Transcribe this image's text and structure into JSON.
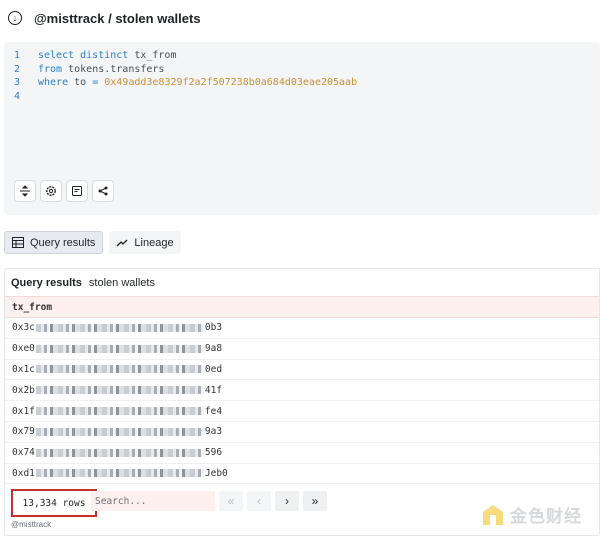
{
  "header": {
    "title": "@misttrack / stolen wallets",
    "back_icon": "arrow-circle-icon"
  },
  "editor": {
    "lines": [
      {
        "num": "1",
        "parts": [
          {
            "t": "kw",
            "v": "select distinct "
          },
          {
            "t": "plain",
            "v": "tx_from"
          }
        ]
      },
      {
        "num": "2",
        "parts": [
          {
            "t": "kw",
            "v": "from "
          },
          {
            "t": "plain",
            "v": "tokens.transfers"
          }
        ]
      },
      {
        "num": "3",
        "parts": [
          {
            "t": "kw",
            "v": "where "
          },
          {
            "t": "plain",
            "v": "to "
          },
          {
            "t": "kw",
            "v": "= "
          },
          {
            "t": "hex",
            "v": "0x49add3e8329f2a2f507238b0a684d03eae205aab"
          }
        ]
      },
      {
        "num": "4",
        "parts": []
      }
    ],
    "toolbar_icons": [
      "collapse-icon",
      "settings-icon",
      "notes-icon",
      "share-icon"
    ]
  },
  "tabs": [
    {
      "label": "Query results",
      "icon": "table-icon",
      "active": true
    },
    {
      "label": "Lineage",
      "icon": "lineage-icon",
      "active": false
    }
  ],
  "results": {
    "title": "Query results",
    "subtitle": "stolen wallets",
    "column": "tx_from",
    "rows": [
      {
        "prefix": "0x3c",
        "suffix": "0b3"
      },
      {
        "prefix": "0xe0",
        "suffix": "9a8"
      },
      {
        "prefix": "0x1c",
        "suffix": "0ed"
      },
      {
        "prefix": "0x2b",
        "suffix": "41f"
      },
      {
        "prefix": "0x1f",
        "suffix": "fe4"
      },
      {
        "prefix": "0x79",
        "suffix": "9a3"
      },
      {
        "prefix": "0x74",
        "suffix": "596"
      },
      {
        "prefix": "0xd1",
        "suffix": "Jeb0"
      }
    ],
    "row_count": "13,334 rows",
    "search_placeholder": "Search...",
    "pager": [
      "«",
      "‹",
      "›",
      "»"
    ]
  },
  "credit": "@misttrack",
  "watermark": "金色财经",
  "colors": {
    "highlight": "#c0312f",
    "keyword": "#2d7fc4",
    "hex_literal": "#c89135"
  }
}
